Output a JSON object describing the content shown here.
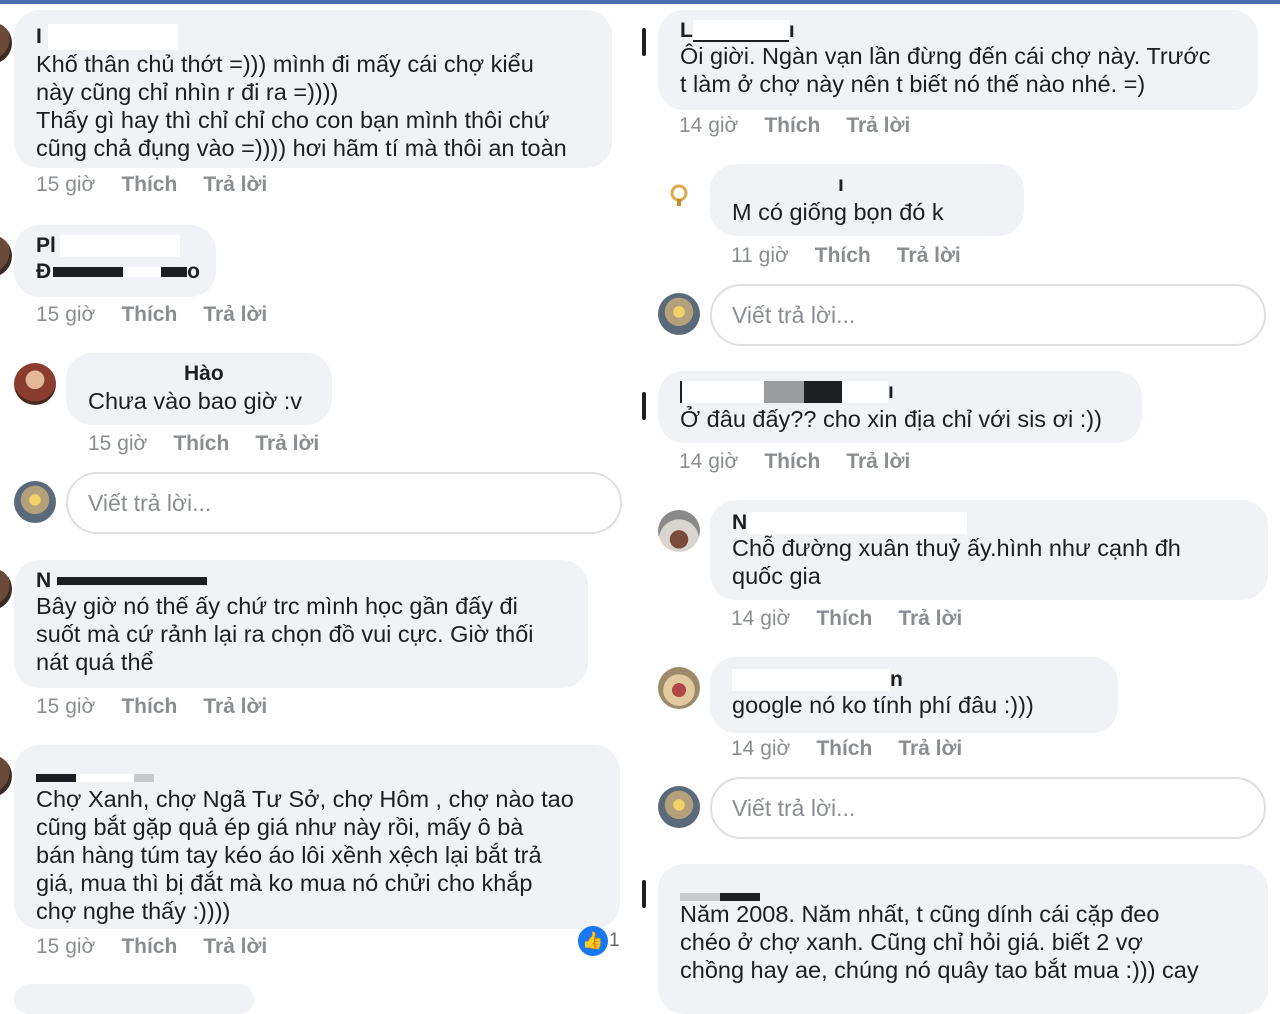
{
  "actions": {
    "like": "Thích",
    "reply": "Trả lời"
  },
  "reply_placeholder": "Viết trả lời...",
  "left": [
    {
      "author": "I",
      "time": "15 giờ",
      "lines": [
        "Khố thân chủ thớt =))) mình đi mấy cái chợ kiểu",
        "này cũng chỉ nhìn r đi ra =))))",
        "Thấy gì hay thì chỉ chỉ cho con bạn mình thôi chứ",
        "cũng chả đụng vào =)))) hơi hãm tí mà thôi an toàn"
      ]
    },
    {
      "author": "Pl",
      "author2": "Đ",
      "author2_end": "o",
      "time": "15 giờ",
      "lines": []
    },
    {
      "author": "Hào",
      "time": "15 giờ",
      "lines": [
        "Chưa vào bao giờ :v"
      ]
    },
    {
      "author": "N",
      "time": "15 giờ",
      "lines": [
        "Bây giờ nó thế ấy chứ trc mình học gần đấy đi",
        "suốt mà cứ rảnh lại ra chọn đồ vui cực. Giờ thối",
        "nát quá thể"
      ]
    },
    {
      "author": "",
      "time": "15 giờ",
      "likes": "1",
      "lines": [
        "Chợ Xanh, chợ Ngã Tư Sở, chợ Hôm ,  chợ nào tao",
        "cũng bắt gặp quả ép giá như này rồi, mấy ô bà",
        "bán hàng túm tay kéo áo lôi xềnh xệch lại bắt trả",
        "giá, mua thì bị đắt mà ko mua nó chửi cho khắp",
        "chợ nghe thấy :))))"
      ]
    }
  ],
  "right": [
    {
      "author": "L",
      "author_end": "ı",
      "time": "14 giờ",
      "lines": [
        "Ôi giời. Ngàn vạn lần đừng đến cái chợ này. Trước",
        "t làm ở chợ này nên t biết nó thế nào nhé. =)"
      ]
    },
    {
      "author": "ı",
      "time": "11 giờ",
      "lines": [
        "M có giống bọn đó k"
      ]
    },
    {
      "author": "ı",
      "time": "14 giờ",
      "lines": [
        "Ở đâu đấy?? cho xin địa chỉ với sis ơi :))"
      ]
    },
    {
      "author": "N",
      "time": "14 giờ",
      "lines": [
        "Chỗ đường xuân thuỷ ấy.hình như cạnh đh",
        "quốc gia"
      ]
    },
    {
      "author": "n",
      "time": "14 giờ",
      "lines": [
        "google nó ko tính phí đâu :)))"
      ]
    },
    {
      "author": "",
      "time": "",
      "lines": [
        "Năm 2008. Năm nhất, t cũng dính cái cặp đeo",
        "chéo ở chợ xanh. Cũng chỉ hỏi giá.          biết 2 vợ",
        "chồng hay ae, chúng nó quây tao bắt mua :))) cay"
      ]
    }
  ]
}
